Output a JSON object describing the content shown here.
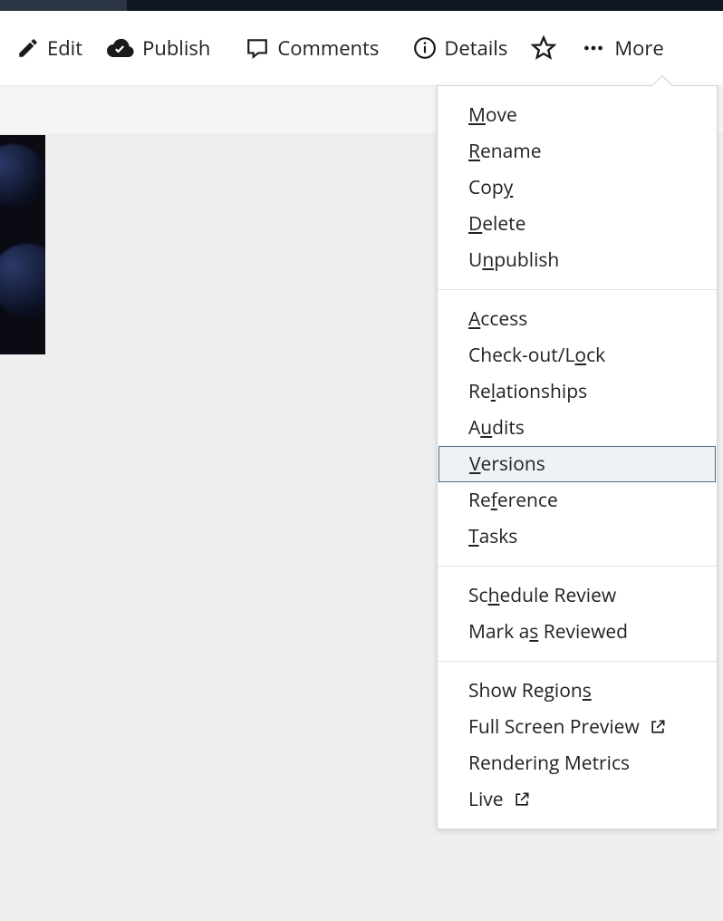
{
  "toolbar": {
    "edit_label": "Edit",
    "publish_label": "Publish",
    "comments_label": "Comments",
    "details_label": "Details",
    "more_label": "More"
  },
  "more_menu": {
    "groups": [
      [
        {
          "before": "",
          "u": "M",
          "after": "ove",
          "name": "menu-move"
        },
        {
          "before": "",
          "u": "R",
          "after": "ename",
          "name": "menu-rename"
        },
        {
          "before": "Cop",
          "u": "y",
          "after": "",
          "name": "menu-copy"
        },
        {
          "before": "",
          "u": "D",
          "after": "elete",
          "name": "menu-delete"
        },
        {
          "before": "U",
          "u": "n",
          "after": "publish",
          "name": "menu-unpublish"
        }
      ],
      [
        {
          "before": "",
          "u": "A",
          "after": "ccess",
          "name": "menu-access"
        },
        {
          "before": "Check-out/L",
          "u": "o",
          "after": "ck",
          "name": "menu-checkout-lock"
        },
        {
          "before": "Re",
          "u": "l",
          "after": "ationships",
          "name": "menu-relationships"
        },
        {
          "before": "A",
          "u": "u",
          "after": "dits",
          "name": "menu-audits"
        },
        {
          "before": "",
          "u": "V",
          "after": "ersions",
          "name": "menu-versions",
          "selected": true
        },
        {
          "before": "Re",
          "u": "f",
          "after": "erence",
          "name": "menu-reference"
        },
        {
          "before": "",
          "u": "T",
          "after": "asks",
          "name": "menu-tasks"
        }
      ],
      [
        {
          "before": "Sc",
          "u": "h",
          "after": "edule Review",
          "name": "menu-schedule-review"
        },
        {
          "before": "Mark a",
          "u": "s",
          "after": " Reviewed",
          "name": "menu-mark-reviewed"
        }
      ],
      [
        {
          "before": "Show Region",
          "u": "s",
          "after": "",
          "name": "menu-show-regions"
        },
        {
          "before": "Full Screen Preview",
          "u": "",
          "after": "",
          "name": "menu-full-screen-preview",
          "external": true
        },
        {
          "before": "Rendering Metrics",
          "u": "",
          "after": "",
          "name": "menu-rendering-metrics"
        },
        {
          "before": "Live",
          "u": "",
          "after": "",
          "name": "menu-live",
          "external": true
        }
      ]
    ]
  }
}
